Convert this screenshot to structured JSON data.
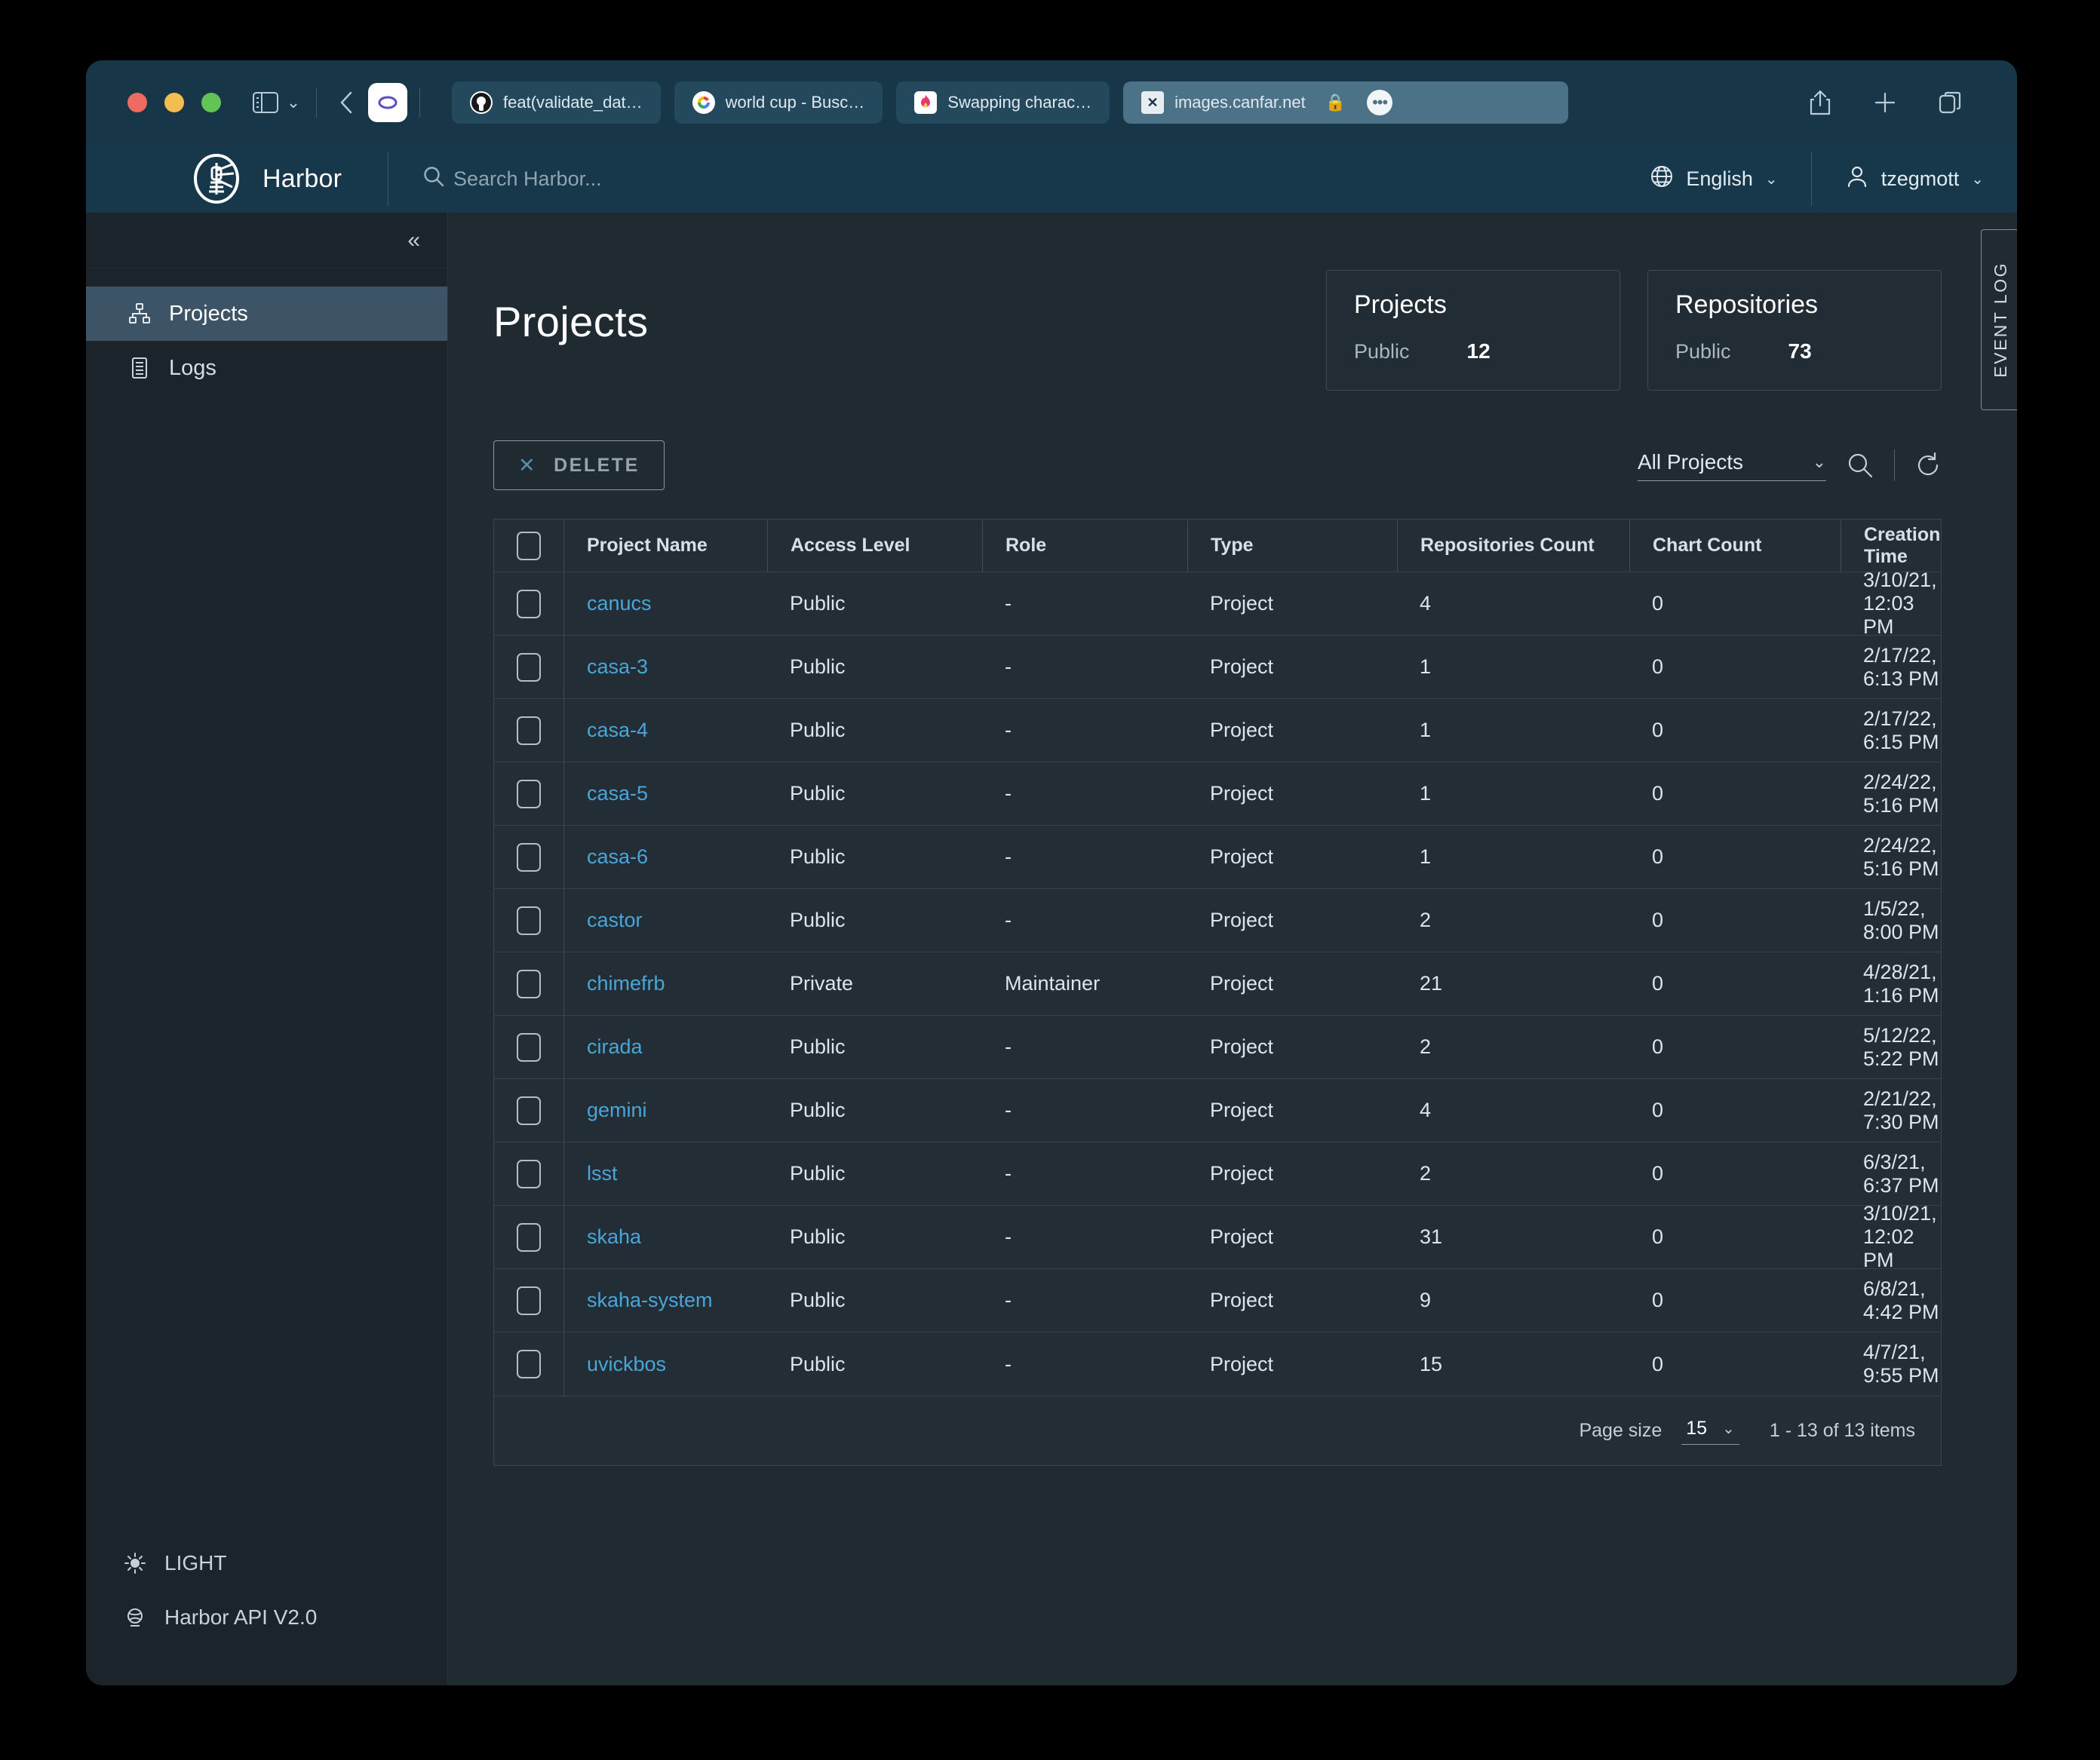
{
  "browser": {
    "traffic_lights": [
      "close",
      "minimize",
      "maximize"
    ],
    "tabs": [
      {
        "favicon": "github-icon",
        "title": "feat(validate_dat…",
        "active": false
      },
      {
        "favicon": "google-icon",
        "title": "world cup - Busc…",
        "active": false
      },
      {
        "favicon": "flame-icon",
        "title": "Swapping charac…",
        "active": false
      },
      {
        "favicon": "x-icon",
        "title": "images.canfar.net",
        "active": true,
        "lock": "🔒",
        "more": "•••"
      }
    ],
    "toolbar_icons": [
      "sidebar-toggle-icon",
      "chevron-down-icon",
      "back-icon",
      "share-icon",
      "new-tab-icon",
      "tab-overview-icon"
    ]
  },
  "header": {
    "brand": "Harbor",
    "search_placeholder": "Search Harbor...",
    "language": "English",
    "user": "tzegmott"
  },
  "sidebar": {
    "collapse_icon": "«",
    "items": [
      {
        "label": "Projects",
        "icon": "projects-icon",
        "active": true
      },
      {
        "label": "Logs",
        "icon": "logs-icon",
        "active": false
      }
    ],
    "bottom_items": [
      {
        "label": "LIGHT",
        "icon": "sun-icon"
      },
      {
        "label": "Harbor API V2.0",
        "icon": "api-icon"
      }
    ]
  },
  "main": {
    "page_title": "Projects",
    "event_log_label": "EVENT LOG",
    "stat_cards": [
      {
        "title": "Projects",
        "label": "Public",
        "value": "12"
      },
      {
        "title": "Repositories",
        "label": "Public",
        "value": "73"
      }
    ],
    "toolbar": {
      "delete_label": "DELETE",
      "filter_value": "All Projects",
      "search_icon": "search-icon",
      "refresh_icon": "refresh-icon"
    },
    "table": {
      "columns": [
        "Project Name",
        "Access Level",
        "Role",
        "Type",
        "Repositories Count",
        "Chart Count",
        "Creation Time"
      ],
      "rows": [
        {
          "name": "canucs",
          "access": "Public",
          "role": "-",
          "type": "Project",
          "repos": "4",
          "charts": "0",
          "created": "3/10/21, 12:03 PM"
        },
        {
          "name": "casa-3",
          "access": "Public",
          "role": "-",
          "type": "Project",
          "repos": "1",
          "charts": "0",
          "created": "2/17/22, 6:13 PM"
        },
        {
          "name": "casa-4",
          "access": "Public",
          "role": "-",
          "type": "Project",
          "repos": "1",
          "charts": "0",
          "created": "2/17/22, 6:15 PM"
        },
        {
          "name": "casa-5",
          "access": "Public",
          "role": "-",
          "type": "Project",
          "repos": "1",
          "charts": "0",
          "created": "2/24/22, 5:16 PM"
        },
        {
          "name": "casa-6",
          "access": "Public",
          "role": "-",
          "type": "Project",
          "repos": "1",
          "charts": "0",
          "created": "2/24/22, 5:16 PM"
        },
        {
          "name": "castor",
          "access": "Public",
          "role": "-",
          "type": "Project",
          "repos": "2",
          "charts": "0",
          "created": "1/5/22, 8:00 PM"
        },
        {
          "name": "chimefrb",
          "access": "Private",
          "role": "Maintainer",
          "type": "Project",
          "repos": "21",
          "charts": "0",
          "created": "4/28/21, 1:16 PM"
        },
        {
          "name": "cirada",
          "access": "Public",
          "role": "-",
          "type": "Project",
          "repos": "2",
          "charts": "0",
          "created": "5/12/22, 5:22 PM"
        },
        {
          "name": "gemini",
          "access": "Public",
          "role": "-",
          "type": "Project",
          "repos": "4",
          "charts": "0",
          "created": "2/21/22, 7:30 PM"
        },
        {
          "name": "lsst",
          "access": "Public",
          "role": "-",
          "type": "Project",
          "repos": "2",
          "charts": "0",
          "created": "6/3/21, 6:37 PM"
        },
        {
          "name": "skaha",
          "access": "Public",
          "role": "-",
          "type": "Project",
          "repos": "31",
          "charts": "0",
          "created": "3/10/21, 12:02 PM"
        },
        {
          "name": "skaha-system",
          "access": "Public",
          "role": "-",
          "type": "Project",
          "repos": "9",
          "charts": "0",
          "created": "6/8/21, 4:42 PM"
        },
        {
          "name": "uvickbos",
          "access": "Public",
          "role": "-",
          "type": "Project",
          "repos": "15",
          "charts": "0",
          "created": "4/7/21, 9:55 PM"
        }
      ],
      "footer": {
        "page_size_label": "Page size",
        "page_size_value": "15",
        "items_range": "1 - 13 of 13 items"
      }
    }
  },
  "colors": {
    "chrome_bg": "#17384b",
    "tab_active": "#4c7288",
    "app_bg": "#1f2a31",
    "sidebar_bg": "#1b242b",
    "sidebar_active": "#3d5366",
    "link": "#4aa5d8"
  }
}
